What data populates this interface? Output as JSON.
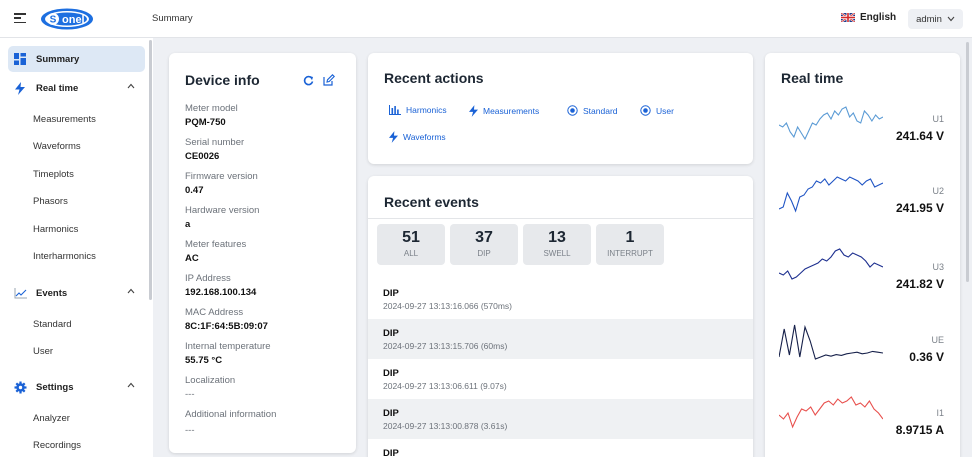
{
  "header": {
    "breadcrumb": "Summary",
    "language": "English",
    "user": "admin",
    "brand": "Sonel",
    "accent": "#1a62d6"
  },
  "sidebar": {
    "items": [
      {
        "label": "Summary",
        "icon": "dashboard-icon",
        "type": "item",
        "active": true
      },
      {
        "label": "Real time",
        "icon": "bolt-icon",
        "type": "group"
      },
      {
        "label": "Measurements",
        "type": "sub"
      },
      {
        "label": "Waveforms",
        "type": "sub"
      },
      {
        "label": "Timeplots",
        "type": "sub"
      },
      {
        "label": "Phasors",
        "type": "sub"
      },
      {
        "label": "Harmonics",
        "type": "sub"
      },
      {
        "label": "Interharmonics",
        "type": "sub"
      },
      {
        "label": "Events",
        "icon": "chart-line-icon",
        "type": "group"
      },
      {
        "label": "Standard",
        "type": "sub"
      },
      {
        "label": "User",
        "type": "sub"
      },
      {
        "label": "Settings",
        "icon": "gear-icon",
        "type": "group"
      },
      {
        "label": "Analyzer",
        "type": "sub"
      },
      {
        "label": "Recordings",
        "type": "sub"
      }
    ]
  },
  "device_info": {
    "title": "Device info",
    "fields": [
      {
        "label": "Meter model",
        "value": "PQM-750"
      },
      {
        "label": "Serial number",
        "value": "CE0026"
      },
      {
        "label": "Firmware version",
        "value": "0.47"
      },
      {
        "label": "Hardware version",
        "value": "a"
      },
      {
        "label": "Meter features",
        "value": "AC"
      },
      {
        "label": "IP Address",
        "value": "192.168.100.134"
      },
      {
        "label": "MAC Address",
        "value": "8C:1F:64:5B:09:07"
      },
      {
        "label": "Internal temperature",
        "value": "55.75 °C"
      },
      {
        "label": "Localization",
        "value": "---"
      },
      {
        "label": "Additional information",
        "value": "---"
      }
    ]
  },
  "recent_actions": {
    "title": "Recent actions",
    "actions": [
      {
        "label": "Harmonics",
        "icon": "bar-chart-icon"
      },
      {
        "label": "Measurements",
        "icon": "bolt-icon"
      },
      {
        "label": "Standard",
        "icon": "radio-icon"
      },
      {
        "label": "User",
        "icon": "radio-icon"
      },
      {
        "label": "Waveforms",
        "icon": "bolt-icon"
      }
    ]
  },
  "recent_events": {
    "title": "Recent events",
    "stats": [
      {
        "count": "51",
        "label": "ALL"
      },
      {
        "count": "37",
        "label": "DIP"
      },
      {
        "count": "13",
        "label": "SWELL"
      },
      {
        "count": "1",
        "label": "INTERRUPT"
      }
    ],
    "events": [
      {
        "type": "DIP",
        "time": "2024-09-27 13:13:16.066 (570ms)"
      },
      {
        "type": "DIP",
        "time": "2024-09-27 13:13:15.706 (60ms)"
      },
      {
        "type": "DIP",
        "time": "2024-09-27 13:13:06.611 (9.07s)"
      },
      {
        "type": "DIP",
        "time": "2024-09-27 13:13:00.878 (3.61s)"
      },
      {
        "type": "DIP",
        "time": ""
      }
    ]
  },
  "real_time": {
    "title": "Real time",
    "channels": [
      {
        "name": "U1",
        "value": "241.64 V",
        "color": "#5b9bd5",
        "trace": [
          0.55,
          0.6,
          0.5,
          0.72,
          0.85,
          0.6,
          0.75,
          0.9,
          0.7,
          0.5,
          0.55,
          0.4,
          0.3,
          0.25,
          0.4,
          0.2,
          0.3,
          0.15,
          0.1,
          0.35,
          0.25,
          0.45,
          0.5,
          0.2,
          0.3,
          0.45,
          0.3,
          0.4,
          0.35
        ]
      },
      {
        "name": "U2",
        "value": "241.95 V",
        "color": "#1f54c4",
        "trace": [
          0.9,
          0.85,
          0.5,
          0.7,
          0.95,
          0.6,
          0.55,
          0.4,
          0.35,
          0.2,
          0.25,
          0.15,
          0.3,
          0.2,
          0.1,
          0.15,
          0.2,
          0.1,
          0.15,
          0.2,
          0.3,
          0.2,
          0.15,
          0.35,
          0.3,
          0.25
        ]
      },
      {
        "name": "U3",
        "value": "241.82 V",
        "color": "#1d2f8f",
        "trace": [
          0.75,
          0.8,
          0.7,
          0.9,
          0.85,
          0.75,
          0.65,
          0.6,
          0.55,
          0.5,
          0.4,
          0.45,
          0.35,
          0.2,
          0.15,
          0.3,
          0.35,
          0.25,
          0.3,
          0.35,
          0.45,
          0.6,
          0.5,
          0.55,
          0.6
        ]
      },
      {
        "name": "UE",
        "value": "0.36 V",
        "color": "#16204a",
        "trace": [
          0.9,
          0.2,
          0.85,
          0.1,
          0.9,
          0.15,
          0.5,
          0.95,
          0.9,
          0.85,
          0.88,
          0.84,
          0.86,
          0.82,
          0.8,
          0.78,
          0.82,
          0.8,
          0.76,
          0.78,
          0.8
        ]
      },
      {
        "name": "I1",
        "value": "8.9715 A",
        "color": "#e8504d",
        "trace": [
          0.5,
          0.6,
          0.45,
          0.8,
          0.55,
          0.35,
          0.4,
          0.3,
          0.5,
          0.35,
          0.2,
          0.15,
          0.25,
          0.1,
          0.2,
          0.15,
          0.05,
          0.25,
          0.2,
          0.3,
          0.15,
          0.35,
          0.45,
          0.6
        ]
      }
    ]
  }
}
